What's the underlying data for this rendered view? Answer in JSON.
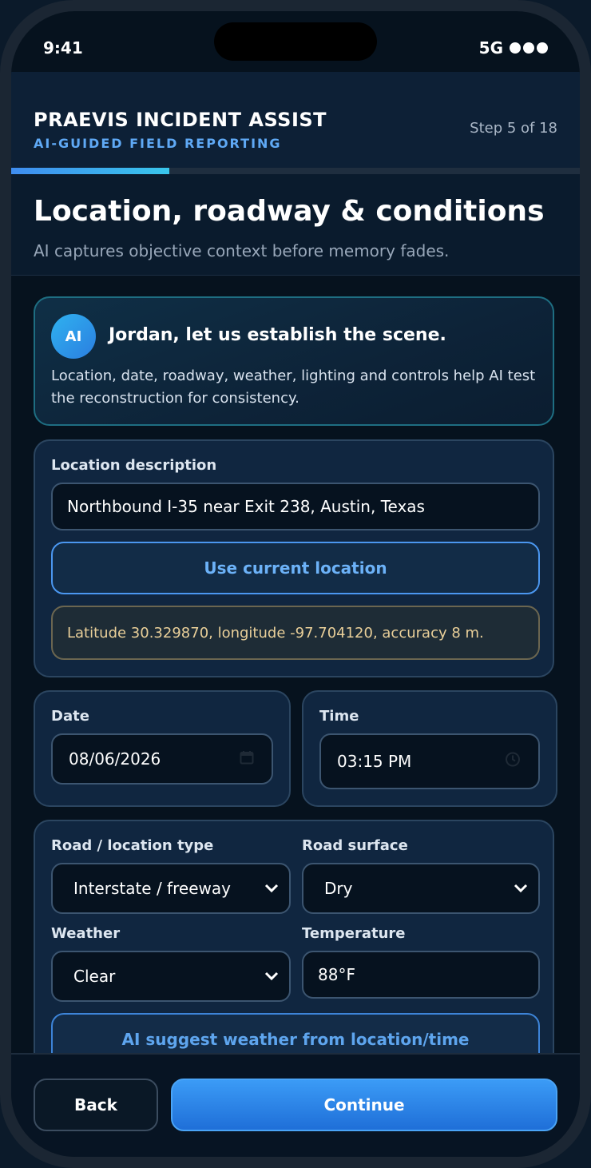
{
  "status_bar": {
    "time": "9:41",
    "network": "5G"
  },
  "header": {
    "title": "PRAEVIS INCIDENT ASSIST",
    "subtitle": "AI-GUIDED FIELD REPORTING",
    "step": "Step 5 of 18",
    "progress": 0.278
  },
  "page": {
    "title": "Location, roadway & conditions",
    "description": "AI captures objective context before memory fades."
  },
  "ai_card": {
    "badge": "AI",
    "heading": "Jordan, let us establish the scene.",
    "body": "Location, date, roadway, weather, lighting and controls help AI test the reconstruction for consistency."
  },
  "location": {
    "label": "Location description",
    "value": "Northbound I-35 near Exit 238, Austin, Texas",
    "use_current_label": "Use current location",
    "coordinates": "Latitude 30.329870, longitude -97.704120, accuracy 8 m."
  },
  "date": {
    "label": "Date",
    "value": "08/06/2026"
  },
  "time": {
    "label": "Time",
    "value": "03:15 PM"
  },
  "conditions": {
    "road_type_label": "Road / location type",
    "road_type_value": "Interstate / freeway",
    "road_surface_label": "Road surface",
    "road_surface_value": "Dry",
    "weather_label": "Weather",
    "weather_value": "Clear",
    "temperature_label": "Temperature",
    "temperature_value": "88°F",
    "ai_suggest_label": "AI suggest weather from location/time"
  },
  "footer": {
    "back_label": "Back",
    "continue_label": "Continue"
  },
  "icons": {
    "calendar": "calendar-icon",
    "clock": "clock-icon",
    "chevron": "chevron-down-icon"
  },
  "colors": {
    "accent": "#3b9bf6",
    "ai_teal": "#2fb2f0",
    "warning_text": "#e9cf99"
  }
}
